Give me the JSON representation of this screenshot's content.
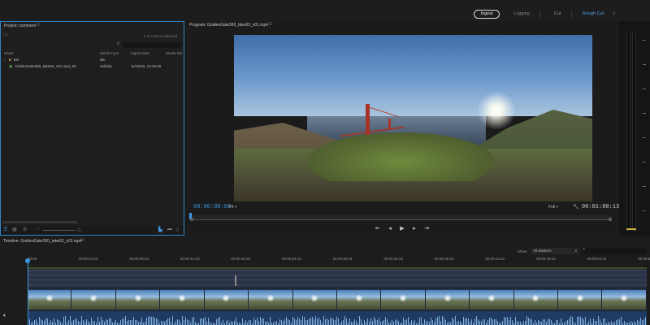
{
  "workspaces": [
    {
      "label": "Ingest",
      "active": true
    },
    {
      "label": "Logging",
      "active": false
    },
    {
      "label": "Cut",
      "active": false
    },
    {
      "label": "Rough Cut",
      "active": false,
      "highlight": true
    }
  ],
  "project": {
    "title": "Project: comment",
    "selection_info": "0 of 2 items selected",
    "columns": [
      "Name",
      "Media Type",
      "Ingest Date",
      "Media Sta"
    ],
    "rows": [
      {
        "name": "Bin",
        "media_type": "Bin",
        "ingest_date": "",
        "icon": "folder-icon"
      },
      {
        "name": "GoldenGate360_take02_v01.mp4_00",
        "media_type": "Subclip",
        "ingest_date": "11/16/16, 13:34:56",
        "icon": "subclip-icon"
      }
    ]
  },
  "program": {
    "title": "Program: GoldenGate360_take02_v01.mp4",
    "timecode_current": "00:00:00:00",
    "timecode_duration": "00:01:00:13",
    "fit_label": "Fit",
    "quality_label": "Full"
  },
  "timeline": {
    "title": "Timeline: GoldenGate360_take02_v01.mp4",
    "show_label": "Show:",
    "markers_value": "All Markers",
    "ruler": [
      "00:00",
      "00:00:04:23",
      "00:00:09:23",
      "00:00:14:23",
      "00:00:19:23",
      "00:00:24:23",
      "00:00:29:23",
      "00:00:34:23",
      "00:00:39:23",
      "00:00:44:22",
      "00:00:49:22",
      "00:00:54:22",
      "00:00:59:"
    ]
  },
  "icons": {
    "search": "search-icon",
    "play": "play-icon",
    "step_back": "step-back-icon",
    "step_forward": "step-forward-icon",
    "mark_in": "mark-in-icon",
    "mark_out": "mark-out-icon",
    "export_frame": "export-frame-icon",
    "wrench": "wrench-icon",
    "speaker": "speaker-icon"
  },
  "colors": {
    "accent": "#3d96df",
    "panel_focus": "#2f86c8"
  }
}
